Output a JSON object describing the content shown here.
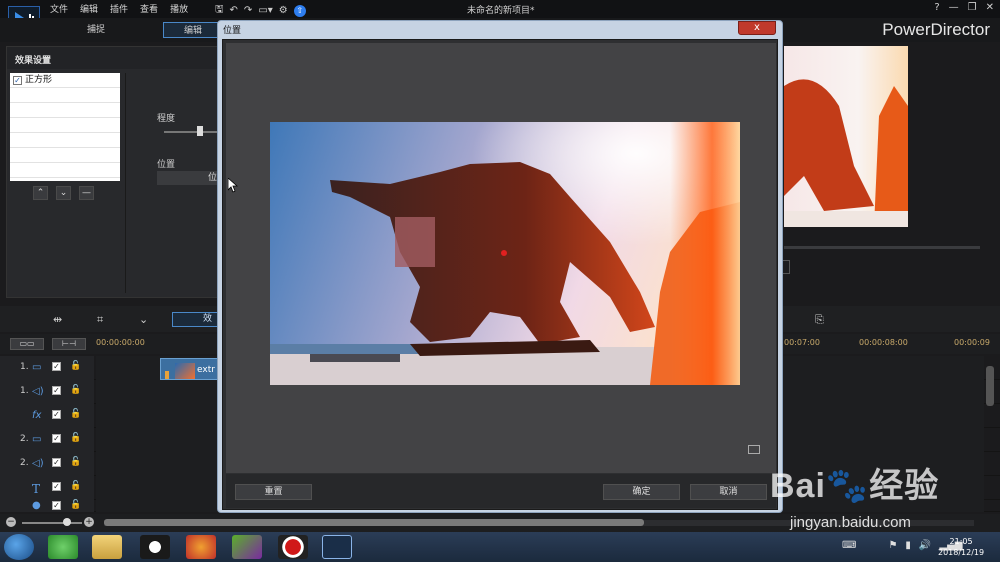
{
  "titlebar": {
    "menu": [
      "文件",
      "编辑",
      "插件",
      "查看",
      "播放"
    ],
    "doc_title": "未命名的新项目*",
    "help": "?",
    "minimize": "—",
    "restore": "❐",
    "close": "✕"
  },
  "tabs": {
    "capture": "捕捉",
    "edit": "编辑"
  },
  "brand": "PowerDirector",
  "effect_panel": {
    "title": "效果设置",
    "items": [
      {
        "label": "正方形",
        "checked": true
      }
    ],
    "degree_label": "程度",
    "degree_value": 0.6,
    "position_label": "位置",
    "position_button": "位"
  },
  "toolbar": {
    "fx_button": "效"
  },
  "timeline": {
    "ruler": [
      "00:00:00:00",
      "00:07:00",
      "00:00:08:00",
      "00:00:09"
    ],
    "tracks": [
      {
        "num": "1.",
        "icon": "video-track-icon",
        "glyph": "▭"
      },
      {
        "num": "1.",
        "icon": "audio-track-icon",
        "glyph": "◁)"
      },
      {
        "num": "",
        "icon": "fx-track-icon",
        "glyph": "fx"
      },
      {
        "num": "2.",
        "icon": "video-track-icon",
        "glyph": "▭"
      },
      {
        "num": "2.",
        "icon": "audio-track-icon",
        "glyph": "◁)"
      },
      {
        "num": "",
        "icon": "title-track-icon",
        "glyph": "T"
      },
      {
        "num": "",
        "icon": "voice-track-icon",
        "glyph": "🎙"
      }
    ],
    "clip_label": "extr"
  },
  "dialog": {
    "title": "位置",
    "close": "x",
    "reset": "重置",
    "ok": "确定",
    "cancel": "取消"
  },
  "taskbar": {
    "time": "21:05",
    "date": "2018/12/19"
  },
  "watermark": {
    "main": "Bai🐾经验",
    "sub": "jingyan.baidu.com"
  },
  "colors": {
    "accent": "#4a88c8",
    "close": "#c0392b",
    "marker": "#e02020"
  }
}
